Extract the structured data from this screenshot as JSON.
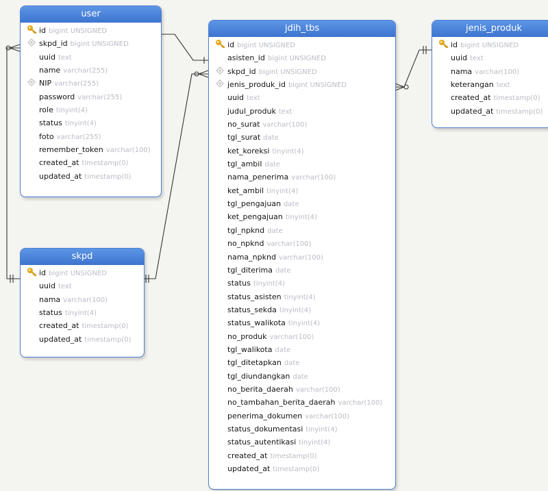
{
  "colors": {
    "header_accent": "#4a86dd",
    "header_text": "#ffffff",
    "type_text": "#b9bcc4",
    "primary_key_icon": "#e3a81a",
    "index_icon": "#c2c2c2",
    "connector": "#333333"
  },
  "tables": [
    {
      "id": "user",
      "title": "user",
      "fields": [
        {
          "name": "id",
          "type": "bigint UNSIGNED",
          "key": "primary"
        },
        {
          "name": "skpd_id",
          "type": "bigint UNSIGNED",
          "key": "index"
        },
        {
          "name": "uuid",
          "type": "text",
          "key": "none"
        },
        {
          "name": "name",
          "type": "varchar(255)",
          "key": "none"
        },
        {
          "name": "NIP",
          "type": "varchar(255)",
          "key": "index"
        },
        {
          "name": "password",
          "type": "varchar(255)",
          "key": "none"
        },
        {
          "name": "role",
          "type": "tinyint(4)",
          "key": "none"
        },
        {
          "name": "status",
          "type": "tinyint(4)",
          "key": "none"
        },
        {
          "name": "foto",
          "type": "varchar(255)",
          "key": "none"
        },
        {
          "name": "remember_token",
          "type": "varchar(100)",
          "key": "none"
        },
        {
          "name": "created_at",
          "type": "timestamp(0)",
          "key": "none"
        },
        {
          "name": "updated_at",
          "type": "timestamp(0)",
          "key": "none"
        }
      ]
    },
    {
      "id": "skpd",
      "title": "skpd",
      "fields": [
        {
          "name": "id",
          "type": "bigint UNSIGNED",
          "key": "primary"
        },
        {
          "name": "uuid",
          "type": "text",
          "key": "none"
        },
        {
          "name": "nama",
          "type": "varchar(100)",
          "key": "none"
        },
        {
          "name": "status",
          "type": "tinyint(4)",
          "key": "none"
        },
        {
          "name": "created_at",
          "type": "timestamp(0)",
          "key": "none"
        },
        {
          "name": "updated_at",
          "type": "timestamp(0)",
          "key": "none"
        }
      ]
    },
    {
      "id": "jdih_tbs",
      "title": "jdih_tbs",
      "fields": [
        {
          "name": "id",
          "type": "bigint UNSIGNED",
          "key": "primary"
        },
        {
          "name": "asisten_id",
          "type": "bigint UNSIGNED",
          "key": "none"
        },
        {
          "name": "skpd_id",
          "type": "bigint UNSIGNED",
          "key": "index"
        },
        {
          "name": "jenis_produk_id",
          "type": "bigint UNSIGNED",
          "key": "index"
        },
        {
          "name": "uuid",
          "type": "text",
          "key": "none"
        },
        {
          "name": "judul_produk",
          "type": "text",
          "key": "none"
        },
        {
          "name": "no_surat",
          "type": "varchar(100)",
          "key": "none"
        },
        {
          "name": "tgl_surat",
          "type": "date",
          "key": "none"
        },
        {
          "name": "ket_koreksi",
          "type": "tinyint(4)",
          "key": "none"
        },
        {
          "name": "tgl_ambil",
          "type": "date",
          "key": "none"
        },
        {
          "name": "nama_penerima",
          "type": "varchar(100)",
          "key": "none"
        },
        {
          "name": "ket_ambil",
          "type": "tinyint(4)",
          "key": "none"
        },
        {
          "name": "tgl_pengajuan",
          "type": "date",
          "key": "none"
        },
        {
          "name": "ket_pengajuan",
          "type": "tinyint(4)",
          "key": "none"
        },
        {
          "name": "tgl_npknd",
          "type": "date",
          "key": "none"
        },
        {
          "name": "no_npknd",
          "type": "varchar(100)",
          "key": "none"
        },
        {
          "name": "nama_npknd",
          "type": "varchar(100)",
          "key": "none"
        },
        {
          "name": "tgl_diterima",
          "type": "date",
          "key": "none"
        },
        {
          "name": "status",
          "type": "tinyint(4)",
          "key": "none"
        },
        {
          "name": "status_asisten",
          "type": "tinyint(4)",
          "key": "none"
        },
        {
          "name": "status_sekda",
          "type": "tinyint(4)",
          "key": "none"
        },
        {
          "name": "status_walikota",
          "type": "tinyint(4)",
          "key": "none"
        },
        {
          "name": "no_produk",
          "type": "varchar(100)",
          "key": "none"
        },
        {
          "name": "tgl_walikota",
          "type": "date",
          "key": "none"
        },
        {
          "name": "tgl_ditetapkan",
          "type": "date",
          "key": "none"
        },
        {
          "name": "tgl_diundangkan",
          "type": "date",
          "key": "none"
        },
        {
          "name": "no_berita_daerah",
          "type": "varchar(100)",
          "key": "none"
        },
        {
          "name": "no_tambahan_berita_daerah",
          "type": "varchar(100)",
          "key": "none"
        },
        {
          "name": "penerima_dokumen",
          "type": "varchar(100)",
          "key": "none"
        },
        {
          "name": "status_dokumentasi",
          "type": "tinyint(4)",
          "key": "none"
        },
        {
          "name": "status_autentikasi",
          "type": "tinyint(4)",
          "key": "none"
        },
        {
          "name": "created_at",
          "type": "timestamp(0)",
          "key": "none"
        },
        {
          "name": "updated_at",
          "type": "timestamp(0)",
          "key": "none"
        }
      ]
    },
    {
      "id": "jenis_produk",
      "title": "jenis_produk",
      "fields": [
        {
          "name": "id",
          "type": "bigint UNSIGNED",
          "key": "primary"
        },
        {
          "name": "uuid",
          "type": "text",
          "key": "none"
        },
        {
          "name": "nama",
          "type": "varchar(100)",
          "key": "none"
        },
        {
          "name": "keterangan",
          "type": "text",
          "key": "none"
        },
        {
          "name": "created_at",
          "type": "timestamp(0)",
          "key": "none"
        },
        {
          "name": "updated_at",
          "type": "timestamp(0)",
          "key": "none"
        }
      ]
    }
  ],
  "relationships": [
    {
      "from": "skpd.id",
      "to": "user.skpd_id"
    },
    {
      "from": "skpd.id",
      "to": "jdih_tbs.skpd_id"
    },
    {
      "from": "user.id",
      "to": "jdih_tbs.asisten_id"
    },
    {
      "from": "jenis_produk.id",
      "to": "jdih_tbs.jenis_produk_id"
    }
  ]
}
